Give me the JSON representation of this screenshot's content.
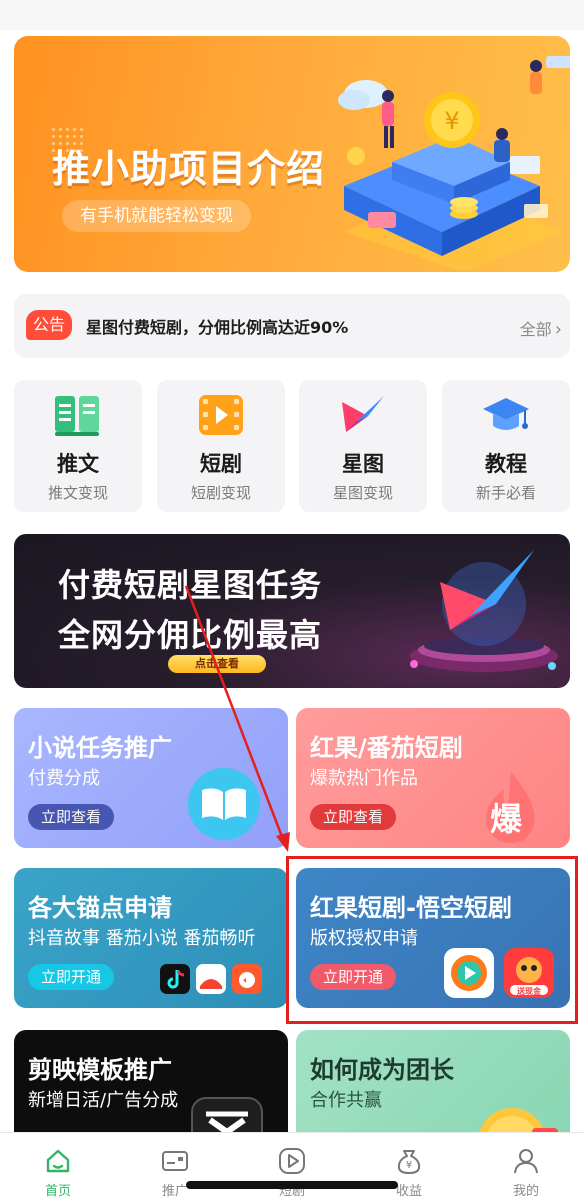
{
  "hero": {
    "title": "推小助项目介绍",
    "subtitle": "有手机就能轻松变现"
  },
  "notice": {
    "tag": "公告",
    "text": "星图付费短剧，分佣比例高达近90%",
    "more": "全部"
  },
  "categories": [
    {
      "title": "推文",
      "subtitle": "推文变现",
      "icon": "book-icon"
    },
    {
      "title": "短剧",
      "subtitle": "短剧变现",
      "icon": "film-icon"
    },
    {
      "title": "星图",
      "subtitle": "星图变现",
      "icon": "xingtu-logo-icon"
    },
    {
      "title": "教程",
      "subtitle": "新手必看",
      "icon": "graduation-cap-icon"
    }
  ],
  "banner": {
    "line1": "付费短剧星图任务",
    "line2": "全网分佣比例最高",
    "button": "点击查看"
  },
  "cards": {
    "novel": {
      "title": "小说任务推广",
      "subtitle": "付费分成",
      "button": "立即查看"
    },
    "hongguo": {
      "title": "红果/番茄短剧",
      "subtitle": "爆款热门作品",
      "button": "立即查看",
      "badge": "爆"
    },
    "anchor": {
      "title": "各大锚点申请",
      "subtitle": "抖音故事 番茄小说 番茄畅听",
      "button": "立即开通"
    },
    "wukong": {
      "title": "红果短剧-悟空短剧",
      "subtitle": "版权授权申请",
      "button": "立即开通",
      "app_tag": "送现金"
    },
    "jianying": {
      "title": "剪映模板推广",
      "subtitle": "新增日活/广告分成"
    },
    "tuanzhang": {
      "title": "如何成为团长",
      "subtitle": "合作共赢"
    }
  },
  "tabbar": [
    {
      "label": "首页",
      "icon": "home-icon",
      "active": true
    },
    {
      "label": "推广",
      "icon": "card-icon",
      "active": false
    },
    {
      "label": "短剧",
      "icon": "play-icon",
      "active": false
    },
    {
      "label": "收益",
      "icon": "money-bag-icon",
      "active": false
    },
    {
      "label": "我的",
      "icon": "user-icon",
      "active": false
    }
  ],
  "colors": {
    "accent_green": "#34b36a",
    "annotation_red": "#e41f1f",
    "notice_tag": "#ff4d3a"
  }
}
